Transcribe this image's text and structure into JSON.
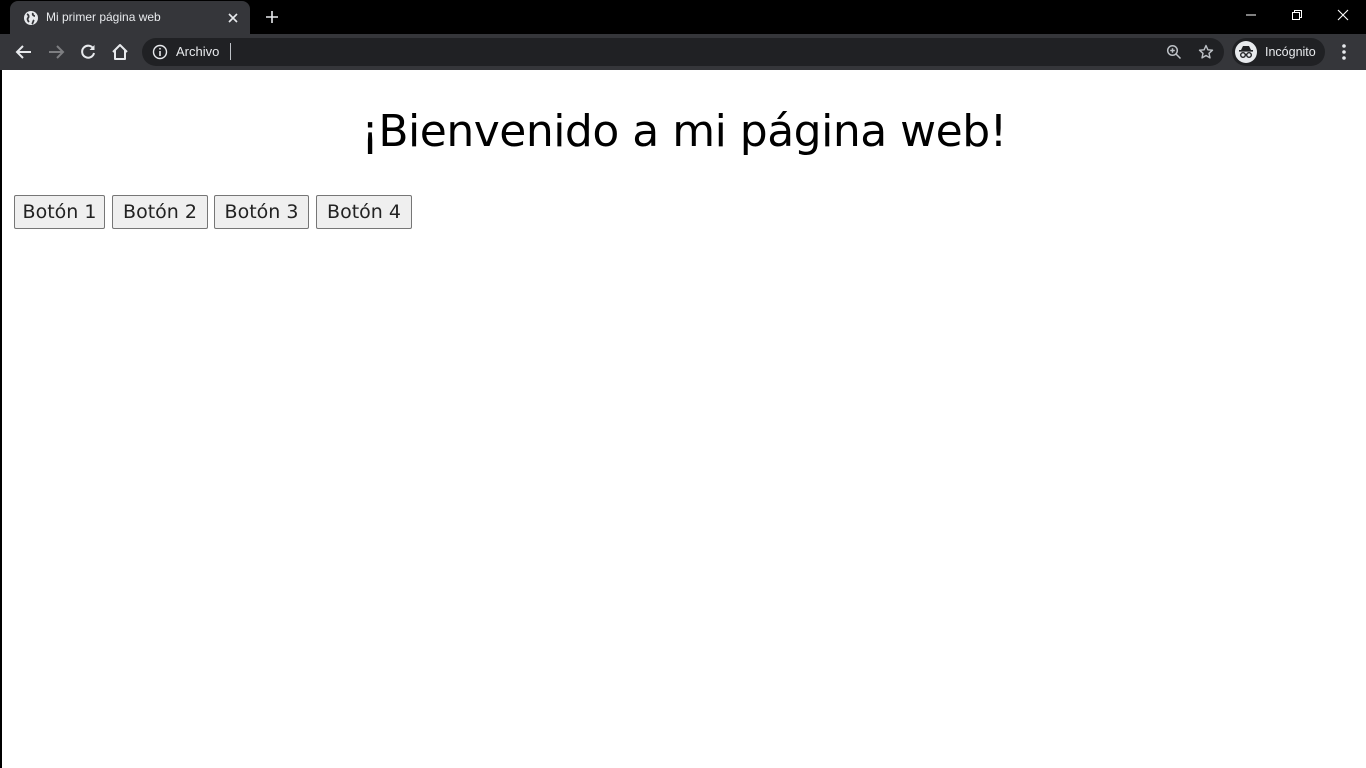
{
  "browser": {
    "tab": {
      "title": "Mi primer página web"
    },
    "address_bar": {
      "site_info": "Archivo"
    },
    "profile": {
      "label": "Incógnito"
    }
  },
  "page": {
    "heading": "¡Bienvenido a mi página web!",
    "buttons": [
      {
        "label": "Botón 1"
      },
      {
        "label": "Botón 2"
      },
      {
        "label": "Botón 3"
      },
      {
        "label": "Botón 4"
      }
    ]
  }
}
